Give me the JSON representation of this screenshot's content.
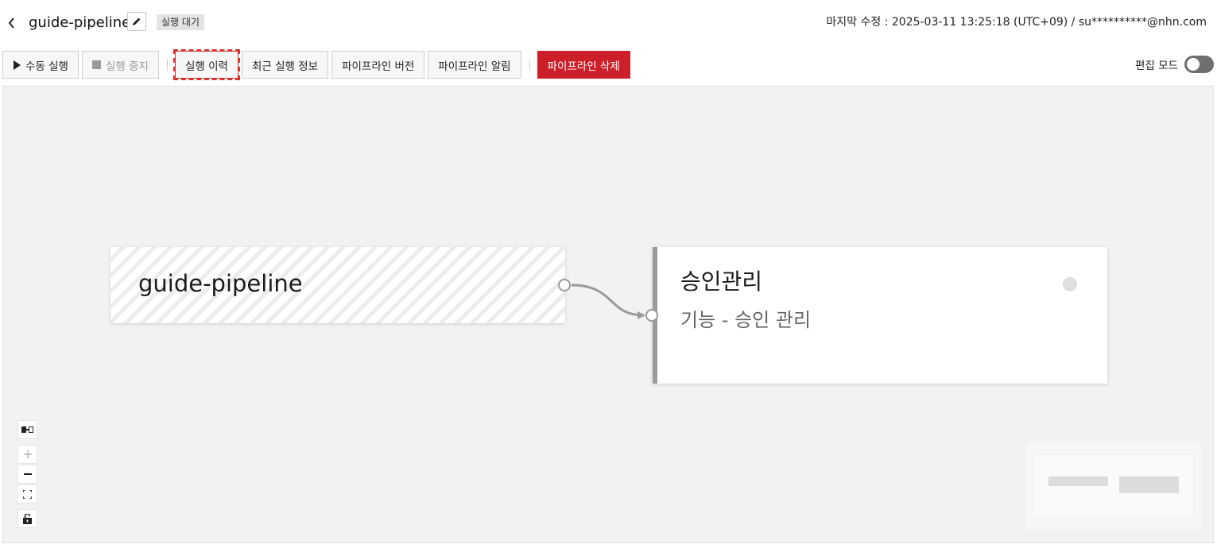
{
  "header": {
    "title": "guide-pipeline",
    "status_badge": "실행 대기",
    "last_modified": "마지막 수정 : 2025-03-11 13:25:18 (UTC+09) / su**********@nhn.com"
  },
  "toolbar": {
    "manual_run": "수동 실행",
    "stop_run": "실행 중지",
    "run_history": "실행 이력",
    "recent_run_info": "최근 실행 정보",
    "pipeline_version": "파이프라인 버전",
    "pipeline_alarm": "파이프라인 알림",
    "delete_pipeline": "파이프라인 삭제",
    "edit_mode_label": "편집 모드",
    "edit_mode_on": false
  },
  "canvas": {
    "nodes": [
      {
        "title": "guide-pipeline"
      },
      {
        "title": "승인관리",
        "subtitle": "기능 - 승인 관리"
      }
    ]
  },
  "colors": {
    "danger": "#cc1f2a",
    "highlight": "#d8322f",
    "canvas_bg": "#f2f2f2",
    "toggle_off": "#6f6f6f"
  },
  "icons": {
    "back": "chevron-left-icon",
    "edit": "pencil-icon",
    "play": "play-icon",
    "stop": "stop-icon",
    "fit_nodes": "fit-nodes-icon",
    "zoom_in": "plus-icon",
    "zoom_out": "minus-icon",
    "fit_view": "fit-view-icon",
    "lock": "unlock-icon"
  }
}
